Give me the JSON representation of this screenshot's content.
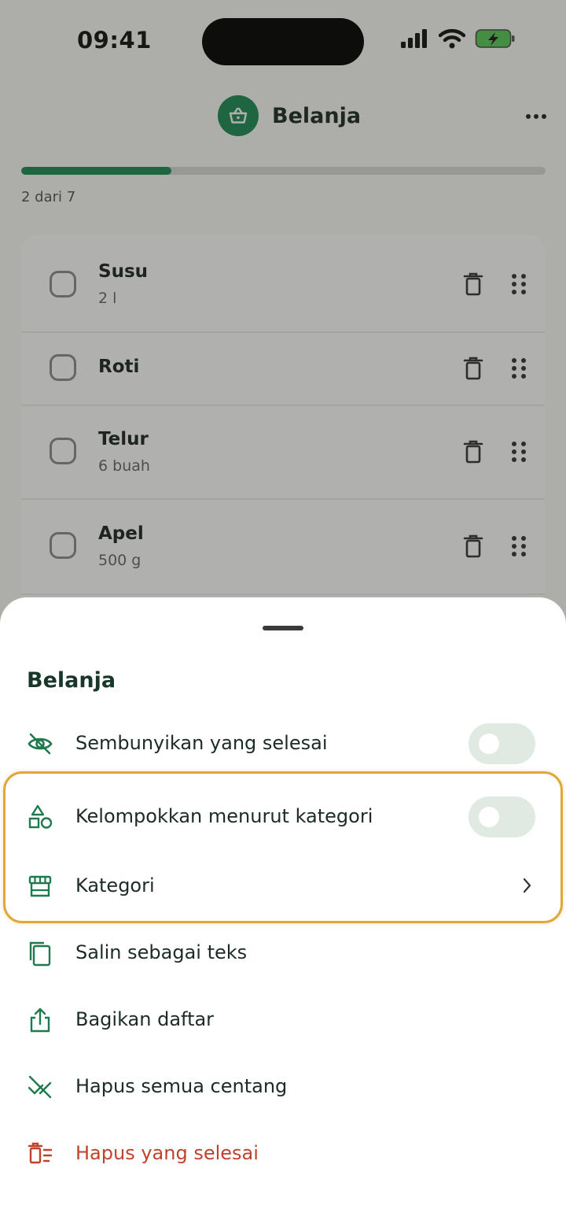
{
  "status_bar": {
    "time": "09:41"
  },
  "header": {
    "title": "Belanja",
    "icon": "basket-icon"
  },
  "progress": {
    "text": "2 dari 7",
    "fraction": 0.2857
  },
  "items": [
    {
      "name": "Susu",
      "qty": "2 l"
    },
    {
      "name": "Roti",
      "qty": ""
    },
    {
      "name": "Telur",
      "qty": "6 buah"
    },
    {
      "name": "Apel",
      "qty": "500 g"
    }
  ],
  "sheet": {
    "title": "Belanja",
    "hide_done": {
      "label": "Sembunyikan yang selesai",
      "icon": "eye-off-icon",
      "on": false
    },
    "group_by_category": {
      "label": "Kelompokkan menurut kategori",
      "icon": "shapes-icon",
      "on": false
    },
    "categories": {
      "label": "Kategori",
      "icon": "store-icon"
    },
    "copy_text": {
      "label": "Salin sebagai teks",
      "icon": "copy-icon"
    },
    "share": {
      "label": "Bagikan daftar",
      "icon": "share-icon"
    },
    "uncheck_all": {
      "label": "Hapus semua centang",
      "icon": "uncheck-icon"
    },
    "delete_done": {
      "label": "Hapus yang selesai",
      "icon": "delete-done-icon"
    }
  },
  "colors": {
    "accent": "#1f8a57",
    "danger": "#c2412a",
    "highlight": "#e0a83a"
  }
}
